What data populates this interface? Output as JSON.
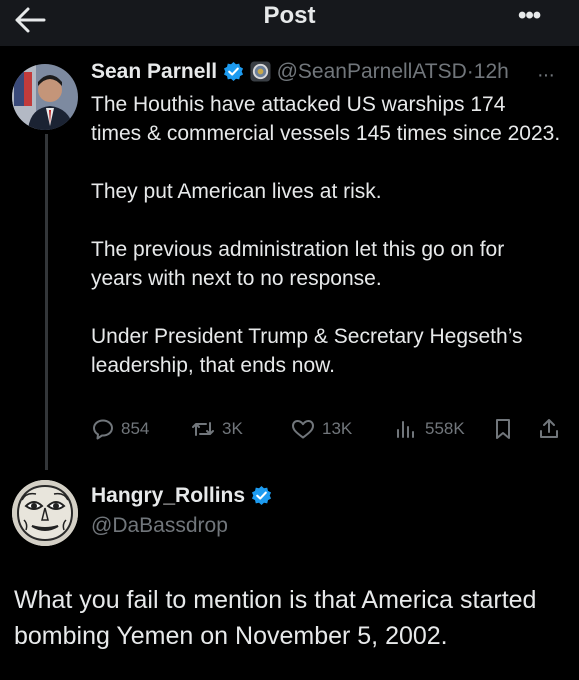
{
  "header": {
    "title": "Post",
    "back_icon": "arrow-left-icon",
    "more_icon": "more-horizontal-icon",
    "more_text": "•••"
  },
  "tweet": {
    "author_name": "Sean Parnell",
    "handle": "@SeanParnellATSD",
    "separator": "·",
    "time": "12h",
    "more_text": "···",
    "verified_color": "#1d9bf0",
    "paragraphs": [
      "The Houthis have attacked US warships 174 times & commercial vessels 145 times since 2023.",
      "They put American lives at risk.",
      "The previous administration let this go on for years with next to no response.",
      "Under President Trump & Secretary Hegseth’s leadership, that ends now."
    ],
    "stats": {
      "replies": "854",
      "reposts": "3K",
      "likes": "13K",
      "views": "558K"
    }
  },
  "reply": {
    "author_name": "Hangry_Rollins",
    "handle": "@DaBassdrop",
    "text": "What you fail to mention  is that America started bombing Yemen on November 5, 2002."
  }
}
